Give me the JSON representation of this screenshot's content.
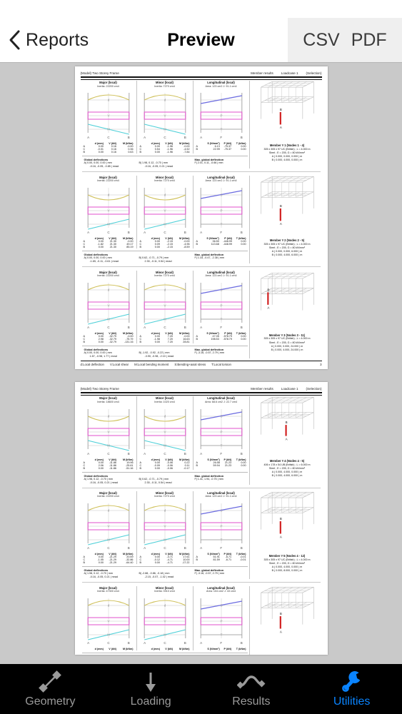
{
  "navbar": {
    "back_label": "Reports",
    "back_icon": "chevron-left-icon",
    "title": "Preview",
    "export_csv": "CSV",
    "export_pdf": "PDF"
  },
  "document": {
    "header": {
      "model": "(Model) Two Storey Frame",
      "result_type": "Member results",
      "loadcase": "Loadcase 1",
      "selection": "(Selection)"
    },
    "footer": {
      "legend": [
        "d:Local deflection",
        "V:Local shear",
        "M:Local bending moment",
        "S:Bending+axial stress",
        "T:Local torsion"
      ],
      "page_number": "3"
    },
    "colors": {
      "deflection_d": "#cfc05a",
      "shear_v": "#e45fd0",
      "moment_m": "#4fd0d8",
      "stress_s": "#6b6be0",
      "axial_p": "#e45fd0",
      "torsion_t": "#9a9a9a",
      "highlight_member": "#d01b1b",
      "frame_line": "#b9b9b9"
    },
    "chart_headers": {
      "major": {
        "title": "Major (local)",
        "sub": "Inertia: 22200 cm4"
      },
      "minor": {
        "title": "Minor (local)",
        "sub": "Inertia: 7270 cm4"
      },
      "longitudinal": {
        "title": "Longitudinal (local)",
        "sub": "Area: 123 cm2  J: 91.1 cm4"
      }
    },
    "table_headers": {
      "bending": [
        "",
        "d (mm)",
        "V (kN)",
        "M (kNm)"
      ],
      "longitudinal": [
        "",
        "S (N/mm²)",
        "P (kN)",
        "T (kNm)"
      ]
    },
    "global_labels": {
      "deflections": "Global deflections",
      "max_deflection": "Max. global deflection"
    },
    "axis_labels": {
      "bending": [
        "A",
        "C",
        "B"
      ],
      "longitudinal": [
        "A",
        "F",
        "B"
      ]
    },
    "curve_labels": {
      "bending": [
        "d",
        "V",
        "M"
      ],
      "longitudinal": [
        "S",
        "P",
        "T"
      ]
    },
    "model_node_labels": [
      "B",
      "A"
    ],
    "pages": [
      {
        "blocks": [
          {
            "major": {
              "title": "Major (local)",
              "sub": "Inertia: 22200 cm4",
              "rows": [
                [
                  "A",
                  "0.00",
                  "0.16",
                  "-0.00"
                ],
                [
                  "C",
                  "-0.01",
                  "0.16",
                  "0.36"
                ],
                [
                  "B",
                  "0.00",
                  "0.16",
                  "0.63"
                ]
              ]
            },
            "minor": {
              "title": "Minor (local)",
              "sub": "Inertia: 7270 cm4",
              "rows": [
                [
                  "A",
                  "0.00",
                  "-1.96",
                  "-0.00"
                ],
                [
                  "C",
                  "0.54",
                  "-1.96",
                  "-4.52"
                ],
                [
                  "B",
                  "0.00",
                  "-1.96",
                  "-7.84"
                ]
              ]
            },
            "longitudinal": {
              "title": "Longitudinal (local)",
              "sub": "Area: 123 cm2  J: 91.1 cm4",
              "rows": [
                [
                  "A",
                  "6.13",
                  "-75.37",
                  "0.00"
                ],
                [
                  "B",
                  "22.99",
                  "-75.37",
                  "0.00"
                ]
              ]
            },
            "global_a": [
              "A|   0.00,   0.00,   0.00  | mm",
              "-0.16, -0.05, -0.85  | mrad"
            ],
            "global_b": [
              "B|   1.98,   0.12, -0.70  | mm",
              "-0.16, -0.05,  0.21  | mrad"
            ],
            "global_max": [
              "F|   2.01,  0.11, -0.66  | mm"
            ],
            "member": {
              "title": "Member # 1  (Nodes 1 - 4)",
              "section": "305 x 305 x 97 UC (British) ;  L = 4.000 m",
              "material": "Steel ;  E = 205,  G = 80 kN/mm²",
              "node_a": "A (  0.000,  0.000,  0.000  ) m",
              "node_b": "B (  0.000,  4.000,  0.000  ) m"
            },
            "curves": {
              "d": "hump-up",
              "v": "flat",
              "m": "down-slope",
              "s": "up-slope"
            }
          },
          {
            "major": {
              "title": "Major (local)",
              "sub": "Inertia: 22200 cm4",
              "rows": [
                [
                  "A",
                  "0.00",
                  "21.30",
                  "-0.00"
                ],
                [
                  "C",
                  "-1.82",
                  "21.30",
                  "49.17"
                ],
                [
                  "B",
                  "0.00",
                  "21.30",
                  "85.19"
                ]
              ]
            },
            "minor": {
              "title": "Minor (local)",
              "sub": "Inertia: 7270 cm4",
              "rows": [
                [
                  "A",
                  "0.00",
                  "-2.15",
                  "-0.00"
                ],
                [
                  "C",
                  "0.09",
                  "-2.15",
                  "-4.96"
                ],
                [
                  "B",
                  "0.00",
                  "-2.15",
                  "-8.59"
                ]
              ]
            },
            "longitudinal": {
              "title": "Longitudinal (local)",
              "sub": "Area: 123 cm2  J: 91.1 cm4",
              "rows": [
                [
                  "A",
                  "36.50",
                  "-448.99",
                  "0.00"
                ],
                [
                  "B",
                  "113.68",
                  "-448.99",
                  "0.00"
                ]
              ]
            },
            "global_a": [
              "A|   0.00,   0.00,   0.00  | mm",
              "-1.65, -0.11, -0.61  | mrad"
            ],
            "global_b": [
              "B|   0.62,  -0.71, -0.79  | mm",
              "2.30,  -0.11,  0.54  | mrad"
            ],
            "global_max": [
              "F|   1.18,  -0.47, -2.38  | mm"
            ],
            "member": {
              "title": "Member # 2  (Nodes 2 - 5)",
              "section": "305 x 305 x 97 UC (British) ;  L = 4.000 m",
              "material": "Steel ;  E = 205,  G = 80 kN/mm²",
              "node_a": "A (  0.000,  0.000,  6.000  ) m",
              "node_b": "B (  0.000,  4.000,  6.000  ) m"
            },
            "curves": {
              "d": "hump-down",
              "v": "flat",
              "m": "up-slope",
              "s": "up-slope"
            }
          },
          {
            "major": {
              "title": "Major (local)",
              "sub": "Inertia: 22200 cm4",
              "rows": [
                [
                  "A",
                  "0.00",
                  "-32.79",
                  "-0.00"
                ],
                [
                  "C",
                  "2.98",
                  "-32.79",
                  "-75.79"
                ],
                [
                  "B",
                  "0.00",
                  "-32.79",
                  "-131.16"
                ]
              ]
            },
            "minor": {
              "title": "Minor (local)",
              "sub": "Inertia: 7270 cm4",
              "rows": [
                [
                  "A",
                  "0.00",
                  "7.20",
                  "-0.00"
                ],
                [
                  "C",
                  "-1.98",
                  "7.20",
                  "16.63"
                ],
                [
                  "B",
                  "0.00",
                  "7.20",
                  "28.81"
                ]
              ]
            },
            "longitudinal": {
              "title": "Longitudinal (local)",
              "sub": "Area: 123 cm2  J: 91.1 cm4",
              "rows": [
                [
                  "A",
                  "47.05",
                  "-578.79",
                  "0.00"
                ],
                [
                  "B",
                  "198.53",
                  "-578.79",
                  "0.00"
                ]
              ]
            },
            "global_a": [
              "A|   0.00,   0.00,   0.00  | mm",
              "1.67, -0.98,  1.77  | mrad"
            ],
            "global_b": [
              "B|  -1.92, -0.92, -0.22  | mm",
              "-3.90, -0.98, -2.10  | mrad"
            ],
            "global_max": [
              "F|  -3.16, -0.57,  2.79  | mm"
            ],
            "member": {
              "title": "Member # 3  (Nodes 3 - 11)",
              "section": "305 x 305 x 97 UC (British) ;  L = 4.000 m",
              "material": "Steel ;  E = 205,  G = 80 kN/mm²",
              "node_a": "A (  0.000,  0.000, 24.000  ) m",
              "node_b": "B (  0.000,  4.000, 24.000  ) m"
            },
            "curves": {
              "d": "hump-up",
              "v": "flat",
              "m": "up-slope",
              "s": "up-slope"
            }
          }
        ]
      },
      {
        "blocks": [
          {
            "major": {
              "title": "Major (local)",
              "sub": "Inertia: 18600 cm4",
              "rows": [
                [
                  "A",
                  "0.00",
                  "-11.86",
                  "19.96"
                ],
                [
                  "C",
                  "2.06",
                  "-11.86",
                  "-25.61"
                ],
                [
                  "B",
                  "0.00",
                  "-11.86",
                  "-51.16"
                ]
              ]
            },
            "minor": {
              "title": "Minor (local)",
              "sub": "Inertia: 1020 cm4",
              "rows": [
                [
                  "A",
                  "0.00",
                  "-0.06",
                  "0.22"
                ],
                [
                  "C",
                  "-0.09",
                  "-0.06",
                  "0.11"
                ],
                [
                  "B",
                  "0.00",
                  "-0.06",
                  "-0.17"
                ]
              ]
            },
            "longitudinal": {
              "title": "Longitudinal (local)",
              "sub": "Area: 68.6 cm2  J: 22.7 cm4",
              "rows": [
                [
                  "A",
                  "26.58",
                  "21.23",
                  "0.00"
                ],
                [
                  "B",
                  "59.94",
                  "21.23",
                  "0.00"
                ]
              ]
            },
            "global_a": [
              "A|   1.98,   0.12, -0.70  | mm",
              "-0.16, -0.05,  0.21  | mrad"
            ],
            "global_b": [
              "B|   0.62,  -0.71, -0.79  | mm",
              "2.30,  -0.11,  0.54  | mrad"
            ],
            "global_max": [
              "F|   1.41,  1.94,  -0.75  | mm"
            ],
            "member": {
              "title": "Member # 4  (Nodes 4 - 5)",
              "section": "406 x 178 x 54 UB (British) ;  L = 6.000 m",
              "material": "Steel ;  E = 205,  G = 80 kN/mm²",
              "node_a": "A (  0.000,  4.000,  0.000  ) m",
              "node_b": "B (  0.000,  4.000,  6.000  ) m"
            },
            "curves": {
              "d": "hump-down",
              "v": "flat",
              "m": "down-slope",
              "s": "up-slope"
            }
          },
          {
            "major": {
              "title": "Major (local)",
              "sub": "Inertia: 22200 cm4",
              "rows": [
                [
                  "A",
                  "0.00",
                  "-21.29",
                  "20.59"
                ],
                [
                  "C",
                  "-1.05",
                  "-21.29",
                  "-32.86"
                ],
                [
                  "B",
                  "0.00",
                  "-21.29",
                  "-64.40"
                ]
              ]
            },
            "minor": {
              "title": "Minor (local)",
              "sub": "Inertia: 7270 cm4",
              "rows": [
                [
                  "A",
                  "0.00",
                  "-4.71",
                  "17.61"
                ],
                [
                  "C",
                  "-0.12",
                  "-4.71",
                  "10.00"
                ],
                [
                  "B",
                  "0.00",
                  "-4.71",
                  "-17.22"
                ]
              ]
            },
            "longitudinal": {
              "title": "Longitudinal (local)",
              "sub": "Area: 123 cm2  J: 91.1 cm4",
              "rows": [
                [
                  "A",
                  "51.91",
                  "-6.71",
                  "-0.01"
                ],
                [
                  "B",
                  "81.59",
                  "-6.71",
                  "-0.01"
                ]
              ]
            },
            "global_a": [
              "A|   1.98,   0.12, -0.70  | mm",
              "-0.16, -0.05,  0.21  | mrad"
            ],
            "global_b": [
              "B|  -2.88, -0.86, -0.18  | mm",
              "-2.15, -0.07, -1.02  | mrad"
            ],
            "global_max": [
              "F|  -3.16, -0.57,  2.79  | mm"
            ],
            "member": {
              "title": "Member # 5  (Nodes 4 - 12)",
              "section": "305 x 305 x 97 UC (British) ;  L = 4.000 m",
              "material": "Steel ;  E = 205,  G = 80 kN/mm²",
              "node_a": "A (  0.000,  4.000,  0.000  ) m",
              "node_b": "B (  0.000,  8.000,  0.000  ) m"
            },
            "curves": {
              "d": "hump-up",
              "v": "flat",
              "m": "up-slope",
              "s": "up-slope"
            }
          },
          {
            "major": {
              "title": "Major (local)",
              "sub": "Inertia: 47300 cm4",
              "rows": [],
              "partial": true
            },
            "minor": {
              "title": "Minor (local)",
              "sub": "Inertia: 3910 cm4",
              "rows": [],
              "partial": true
            },
            "longitudinal": {
              "title": "Longitudinal (local)",
              "sub": "Area: 104 cm2  J: 43 cm4",
              "rows": [],
              "partial": true
            },
            "global_a": [],
            "global_b": [],
            "global_max": [],
            "member": {
              "title": "",
              "section": "",
              "material": "",
              "node_a": "",
              "node_b": ""
            },
            "curves": {
              "d": "hump-up",
              "v": "flat",
              "m": "up-slope",
              "s": "up-slope"
            }
          }
        ]
      }
    ]
  },
  "tabbar": {
    "items": [
      {
        "label": "Geometry",
        "icon": "member-line-icon",
        "active": false
      },
      {
        "label": "Loading",
        "icon": "down-arrow-icon",
        "active": false
      },
      {
        "label": "Results",
        "icon": "wave-curve-icon",
        "active": false
      },
      {
        "label": "Utilities",
        "icon": "wrench-icon",
        "active": true
      }
    ],
    "active_color": "#0a84ff",
    "inactive_color": "#9a9a9a"
  }
}
